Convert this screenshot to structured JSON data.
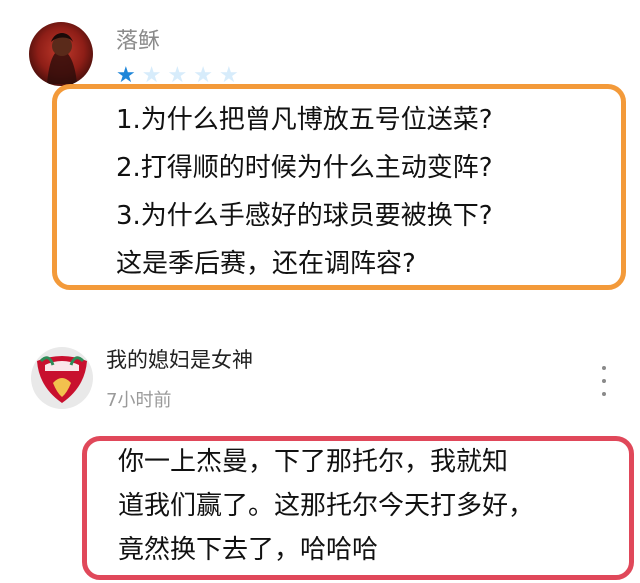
{
  "comments": [
    {
      "username": "落稣",
      "rating": {
        "filled": 1,
        "total": 5
      },
      "lines": [
        "1.为什么把曾凡博放五号位送菜?",
        "2.打得顺的时候为什么主动变阵?",
        "3.为什么手感好的球员要被换下?",
        "这是季后赛，还在调阵容?"
      ],
      "highlight_color": "#f39a3a"
    },
    {
      "username": "我的媳妇是女神",
      "time": "7小时前",
      "avatar_badge": "LIVERPOOL",
      "lines": [
        "你一上杰曼，下了那托尔，我就知",
        "道我们赢了。这那托尔今天打多好，",
        "竟然换下去了，哈哈哈"
      ],
      "highlight_color": "#e0485a"
    }
  ],
  "icons": {
    "star_filled_color": "#1e86d9",
    "star_empty_color": "#d7ecfb",
    "menu": "more-vertical-icon"
  }
}
